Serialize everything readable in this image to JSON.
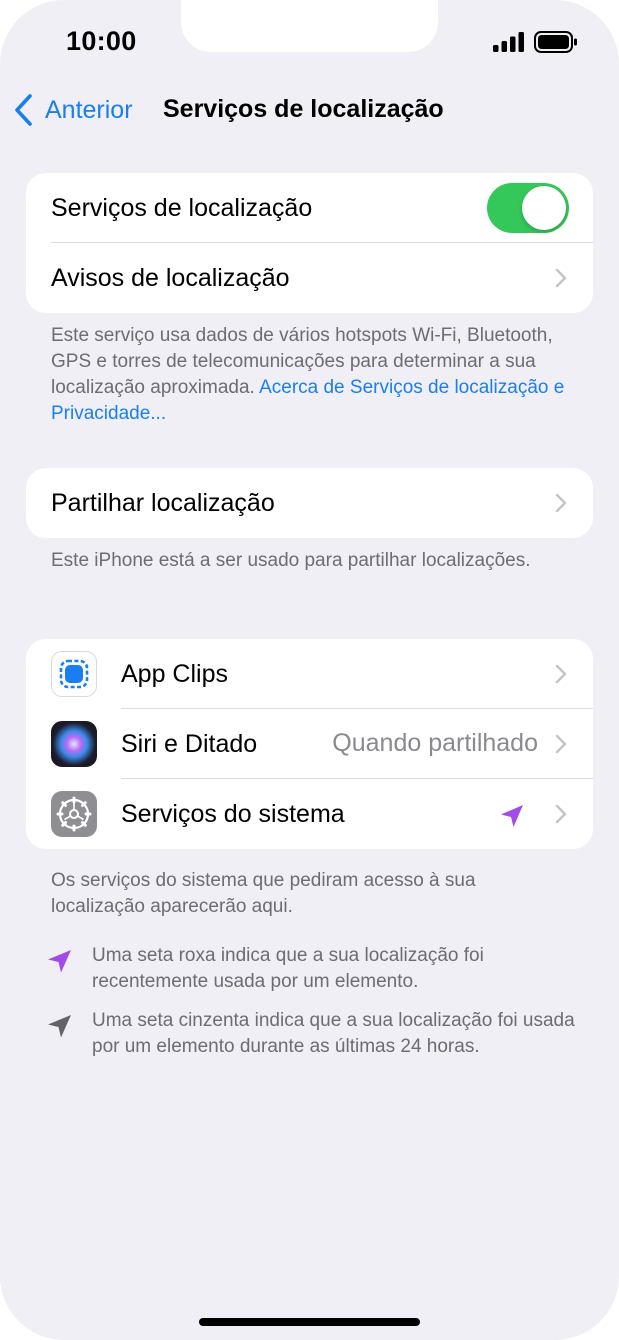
{
  "status": {
    "time": "10:00",
    "signal_icon": "cellular-signal-icon",
    "battery_icon": "battery-icon"
  },
  "nav": {
    "back_label": "Anterior",
    "title": "Serviços de localização"
  },
  "group1": {
    "location_services_label": "Serviços de localização",
    "location_services_enabled": true,
    "location_alerts_label": "Avisos de localização"
  },
  "footnote1": {
    "text": "Este serviço usa dados de vários hotspots Wi-Fi, Bluetooth, GPS e torres de telecomunicações para determinar a sua localização aproximada. ",
    "link": "Acerca de Serviços de localização e Privacidade..."
  },
  "group2": {
    "share_location_label": "Partilhar localização"
  },
  "footnote2": "Este iPhone está a ser usado para partilhar localizações.",
  "apps": [
    {
      "label": "App Clips",
      "icon": "app-clips-icon",
      "value": ""
    },
    {
      "label": "Siri e Ditado",
      "icon": "siri-icon",
      "value": "Quando partilhado"
    },
    {
      "label": "Serviços do sistema",
      "icon": "system-services-gear-icon",
      "value": ""
    }
  ],
  "footnote3": "Os serviços do sistema que pediram acesso à sua localização aparecerão aqui.",
  "legend": [
    {
      "icon": "purple-arrow-icon",
      "text": "Uma seta roxa indica que a sua localização foi recentemente usada por um elemento."
    },
    {
      "icon": "gray-arrow-icon",
      "text": "Uma seta cinzenta indica que a sua localização foi usada por um elemento durante as últimas 24 horas."
    }
  ],
  "colors": {
    "accent": "#1a7ef0",
    "toggle_on": "#34c759",
    "purple_arrow": "#a24be8",
    "gray_arrow": "#636366",
    "background": "#f0eff5"
  }
}
